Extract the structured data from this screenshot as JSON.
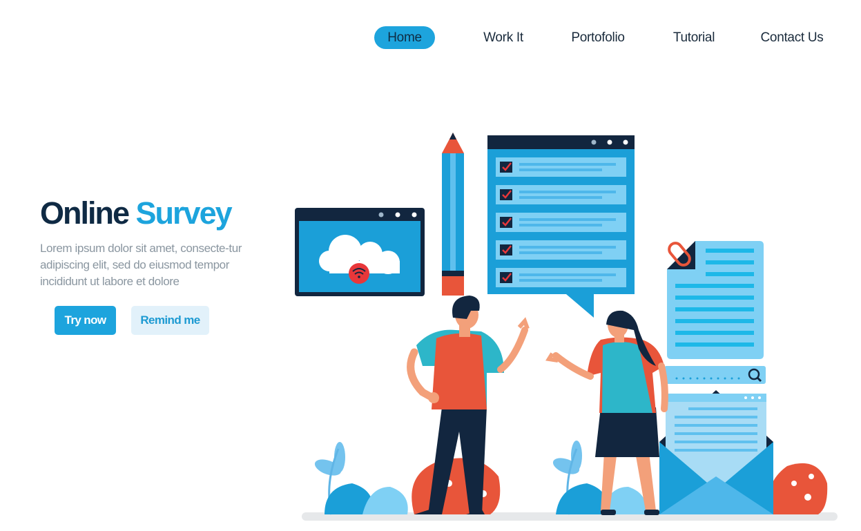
{
  "nav": {
    "items": [
      {
        "label": "Home",
        "active": true
      },
      {
        "label": "Work It",
        "active": false
      },
      {
        "label": "Portofolio",
        "active": false
      },
      {
        "label": "Tutorial",
        "active": false
      },
      {
        "label": "Contact Us",
        "active": false
      }
    ]
  },
  "hero": {
    "title_part1": "Online",
    "title_part2": "Survey",
    "description": "Lorem ipsum dolor sit amet, consecte-tur adipiscing elit, sed do eiusmod tempor incididunt ut labore et dolore",
    "primary_button": "Try now",
    "secondary_button": "Remind me"
  },
  "colors": {
    "accent": "#1da4dd",
    "dark_navy": "#0f2a44",
    "orange_red": "#e8553a",
    "light_blue": "#7fd0f4"
  }
}
